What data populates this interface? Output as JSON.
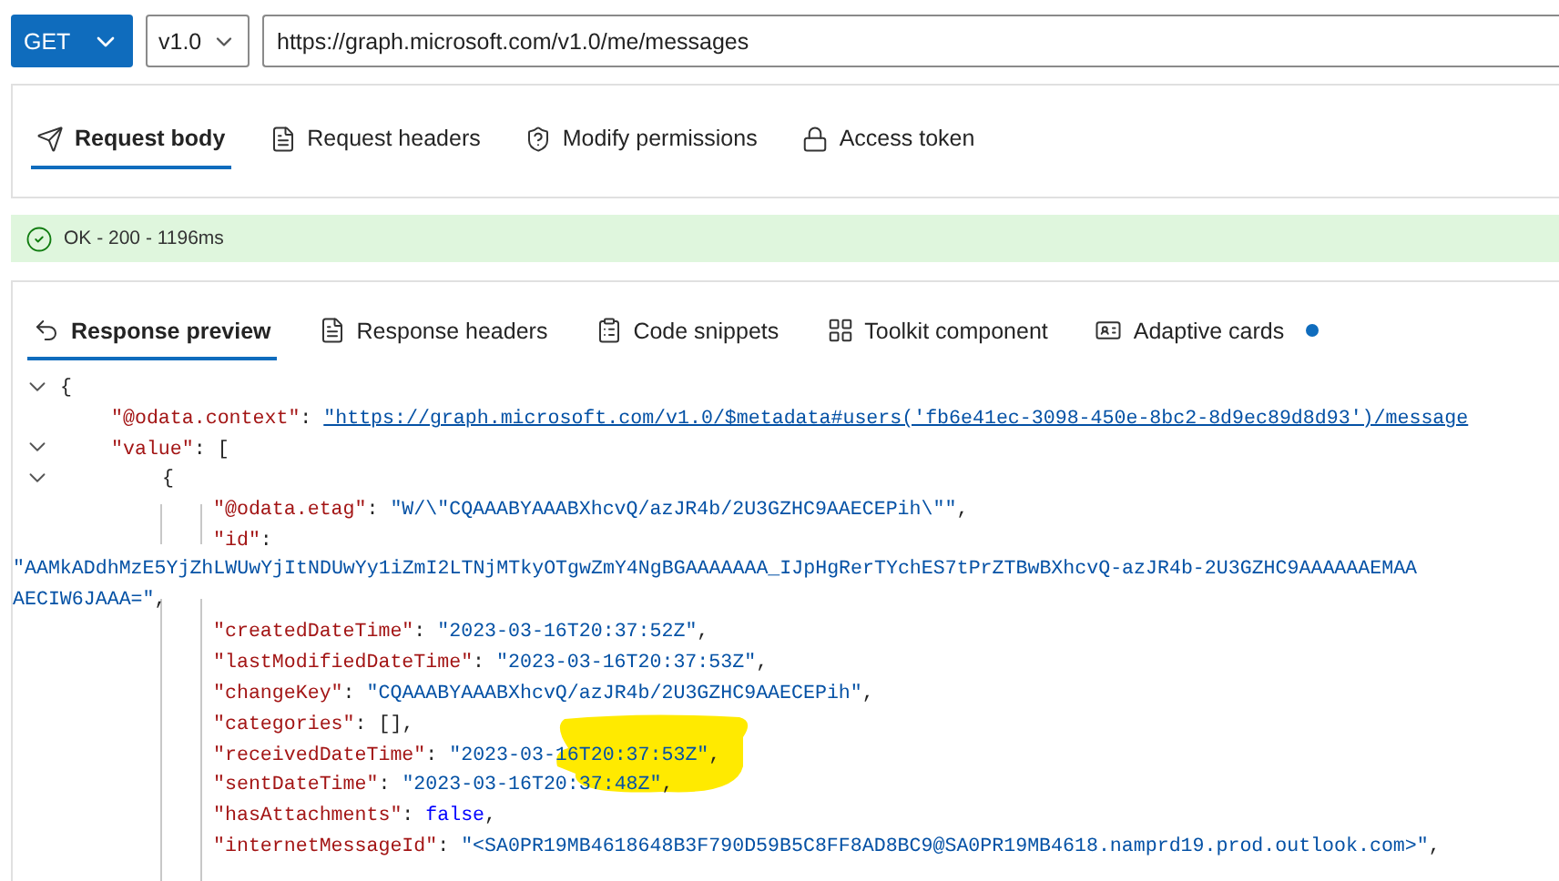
{
  "request_bar": {
    "method": "GET",
    "version": "v1.0",
    "url": "https://graph.microsoft.com/v1.0/me/messages"
  },
  "request_tabs": [
    {
      "label": "Request body",
      "selected": true
    },
    {
      "label": "Request headers",
      "selected": false
    },
    {
      "label": "Modify permissions",
      "selected": false
    },
    {
      "label": "Access token",
      "selected": false
    }
  ],
  "status": {
    "text": "OK - 200 - 1196ms",
    "kind": "success"
  },
  "response_tabs": [
    {
      "label": "Response preview",
      "selected": true,
      "dot": false
    },
    {
      "label": "Response headers",
      "selected": false,
      "dot": false
    },
    {
      "label": "Code snippets",
      "selected": false,
      "dot": false
    },
    {
      "label": "Toolkit component",
      "selected": false,
      "dot": false
    },
    {
      "label": "Adaptive cards",
      "selected": false,
      "dot": true
    }
  ],
  "json_tree": {
    "open": "{",
    "expanded": true,
    "children": [
      {
        "key": "\"@odata.context\"",
        "sep": ":",
        "value": "\"https://graph.microsoft.com/v1.0/$metadata#users('fb6e41ec-3098-450e-8bc2-8d9ec89d8d93')/message",
        "kind": "link"
      },
      {
        "key": "\"value\"",
        "sep": ":",
        "open": "[",
        "expanded": true,
        "children": [
          {
            "open": "{",
            "expanded": true,
            "children": [
              {
                "key": "\"@odata.etag\"",
                "sep": ":",
                "value": "\"W/\\\"CQAAABYAAABXhcvQ/azJR4b/2U3GZHC9AAECEPih\\\"\"",
                "kind": "string",
                "trail": ","
              },
              {
                "key": "\"id\"",
                "sep": ":",
                "wrapped": [
                  "\"AAMkADdhMzE5YjZhLWUwYjItNDUwYy1iZmI2LTNjMTkyOTgwZmY4NgBGAAAAAAA_IJpHgRerTYchES7tPrZTBwBXhcvQ-azJR4b-2U3GZHC9AAAAAAEMAA",
                  "AECIW6JAAA=\""
                ],
                "kind": "string",
                "trail": ","
              },
              {
                "key": "\"createdDateTime\"",
                "sep": ":",
                "value": "\"2023-03-16T20:37:52Z\"",
                "kind": "string",
                "trail": ","
              },
              {
                "key": "\"lastModifiedDateTime\"",
                "sep": ":",
                "value": "\"2023-03-16T20:37:53Z\"",
                "kind": "string",
                "trail": ","
              },
              {
                "key": "\"changeKey\"",
                "sep": ":",
                "value": "\"CQAAABYAAABXhcvQ/azJR4b/2U3GZHC9AAECEPih\"",
                "kind": "string",
                "trail": ","
              },
              {
                "key": "\"categories\"",
                "sep": ":",
                "value": "[]",
                "kind": "punct",
                "trail": ","
              },
              {
                "key": "\"receivedDateTime\"",
                "sep": ":",
                "value": "\"2023-03-16T20:37:53Z\"",
                "kind": "string",
                "trail": ","
              },
              {
                "key": "\"sentDateTime\"",
                "sep": ":",
                "value": "\"2023-03-16T20:37:48Z\"",
                "kind": "string",
                "trail": ","
              },
              {
                "key": "\"hasAttachments\"",
                "sep": ":",
                "value": "false",
                "kind": "bool",
                "trail": ","
              },
              {
                "key": "\"internetMessageId\"",
                "sep": ":",
                "value": "\"<SA0PR19MB4618648B3F790D59B5C8FF8AD8BC9@SA0PR19MB4618.namprd19.prod.outlook.com>\"",
                "kind": "string",
                "trail": ","
              }
            ]
          }
        ]
      }
    ]
  },
  "annotation": {
    "kind": "highlighter"
  }
}
